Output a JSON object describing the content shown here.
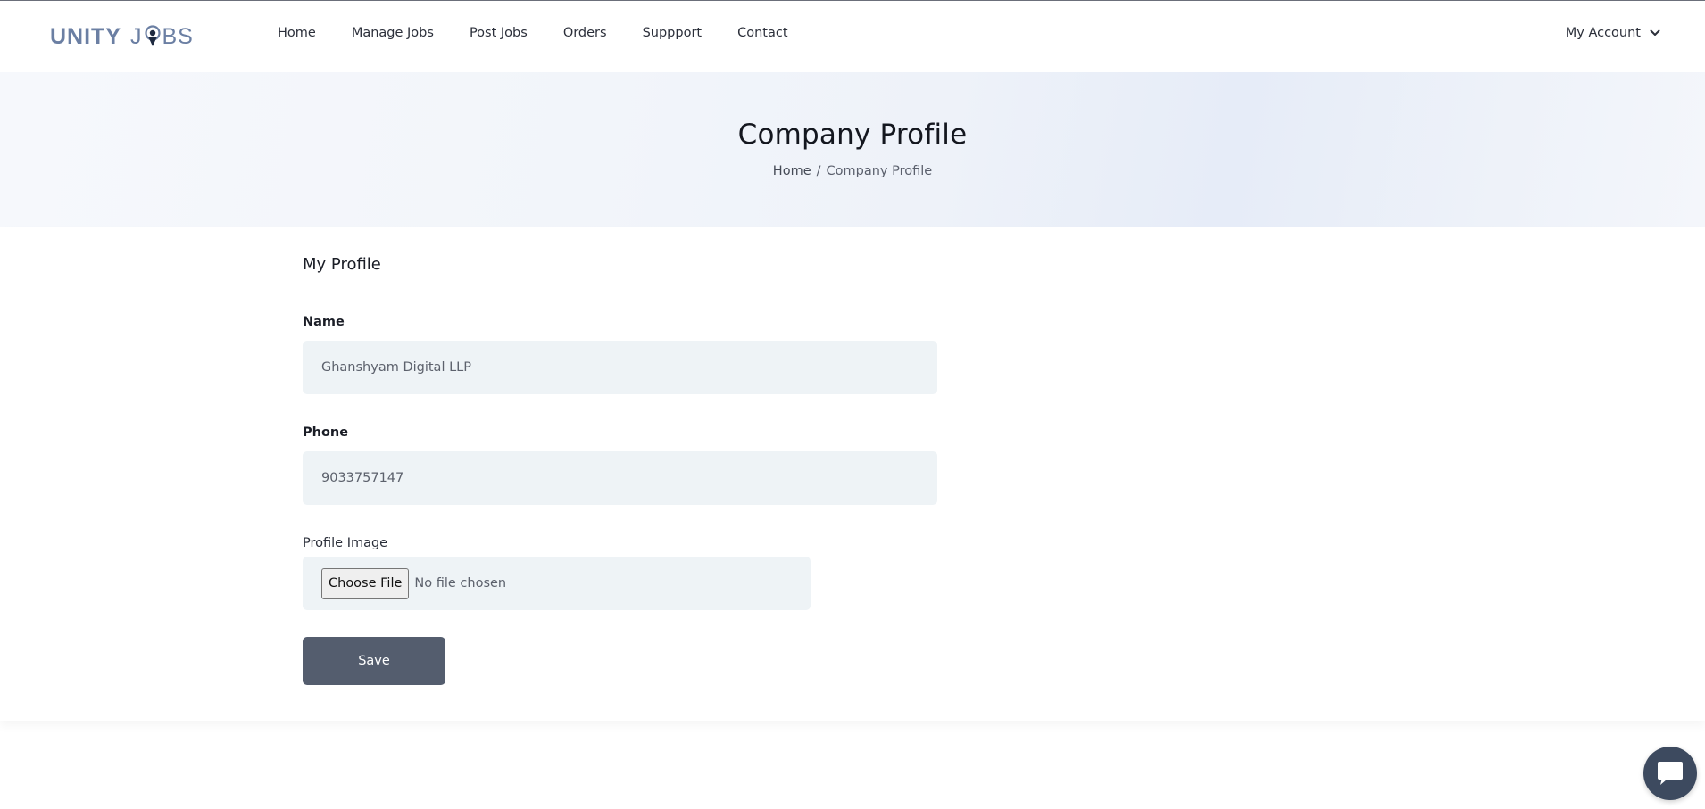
{
  "brand": {
    "logo_part1": "UNITY",
    "logo_part2_a": "J",
    "logo_part2_b": "BS",
    "color": "#6b7fa3"
  },
  "nav": {
    "items": [
      "Home",
      "Manage Jobs",
      "Post Jobs",
      "Orders",
      "Suppport",
      "Contact"
    ],
    "account_label": "My Account"
  },
  "banner": {
    "title": "Company Profile",
    "breadcrumb_home": "Home",
    "breadcrumb_sep": "/",
    "breadcrumb_current": "Company Profile"
  },
  "form": {
    "section_title": "My Profile",
    "name_label": "Name",
    "name_value": "Ghanshyam Digital LLP",
    "phone_label": "Phone",
    "phone_value": "9033757147",
    "image_label": "Profile Image",
    "choose_file_label": "Choose File",
    "file_status": "No file chosen",
    "save_label": "Save"
  },
  "colors": {
    "save_button": "#545d6e",
    "input_bg": "#eef3f6",
    "chat_widget": "#3d4a5f"
  },
  "icons": {
    "account_chevron": "chevron-down-icon",
    "chat": "chat-bubble-icon",
    "logo_pin": "location-pin-icon"
  }
}
